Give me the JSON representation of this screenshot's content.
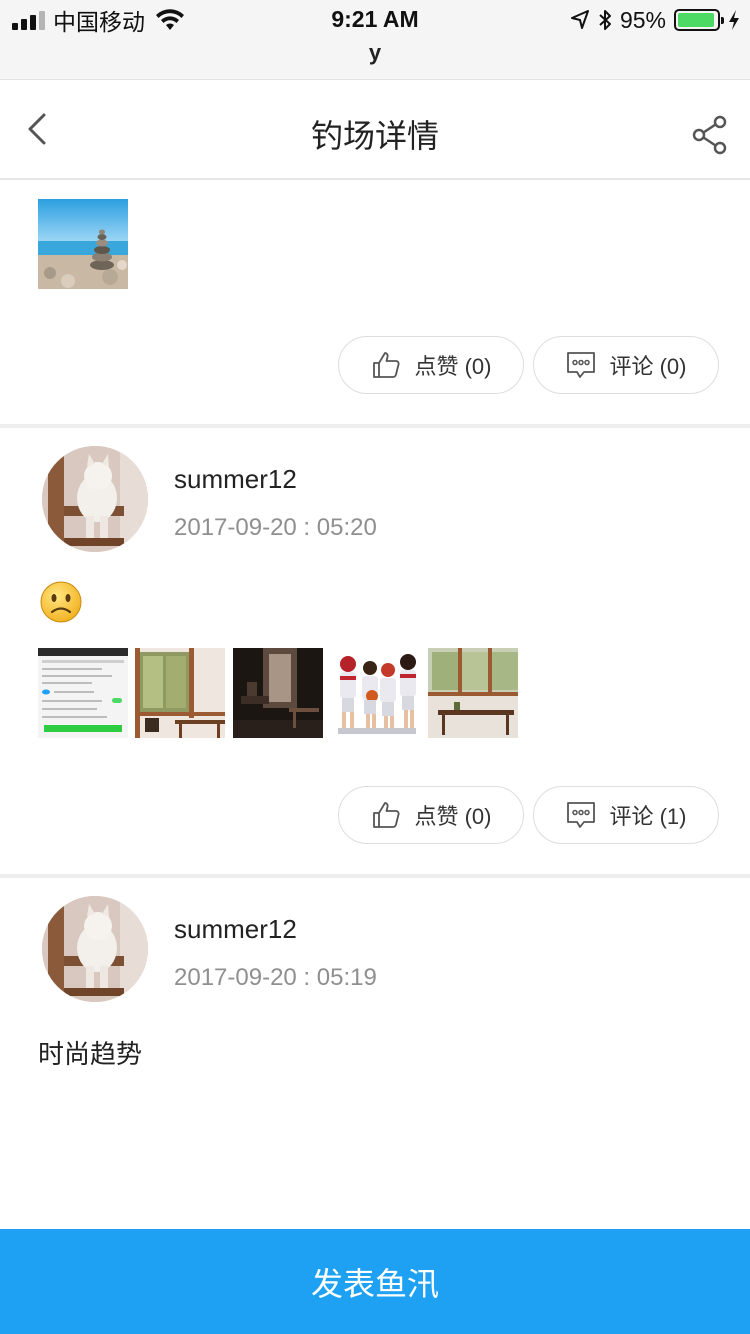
{
  "status_bar": {
    "carrier": "中国移动",
    "time": "9:21 AM",
    "battery_percent": "95%",
    "battery_level": 0.95,
    "sub_text": "y"
  },
  "nav": {
    "title": "钓场详情",
    "back_icon": "chevron-left-icon",
    "share_icon": "share-icon"
  },
  "top_post": {
    "images": [
      "beach-stone-photo"
    ],
    "like_label": "点赞 (0)",
    "comment_label": "评论 (0)"
  },
  "posts": [
    {
      "username": "summer12",
      "timestamp": "2017-09-20 : 05:20",
      "content_emoji": "frown-emoji",
      "images": [
        "app-screenshot",
        "wood-room-photo",
        "dark-room-photo",
        "basketball-players-photo",
        "window-table-photo"
      ],
      "like_label": "点赞 (0)",
      "comment_label": "评论 (1)"
    },
    {
      "username": "summer12",
      "timestamp": "2017-09-20 : 05:19",
      "text": "时尚趋势"
    }
  ],
  "footer": {
    "publish_label": "发表鱼汛"
  },
  "colors": {
    "accent": "#1ea1f3",
    "battery": "#4cd964",
    "muted_text": "#8f8f8f"
  }
}
